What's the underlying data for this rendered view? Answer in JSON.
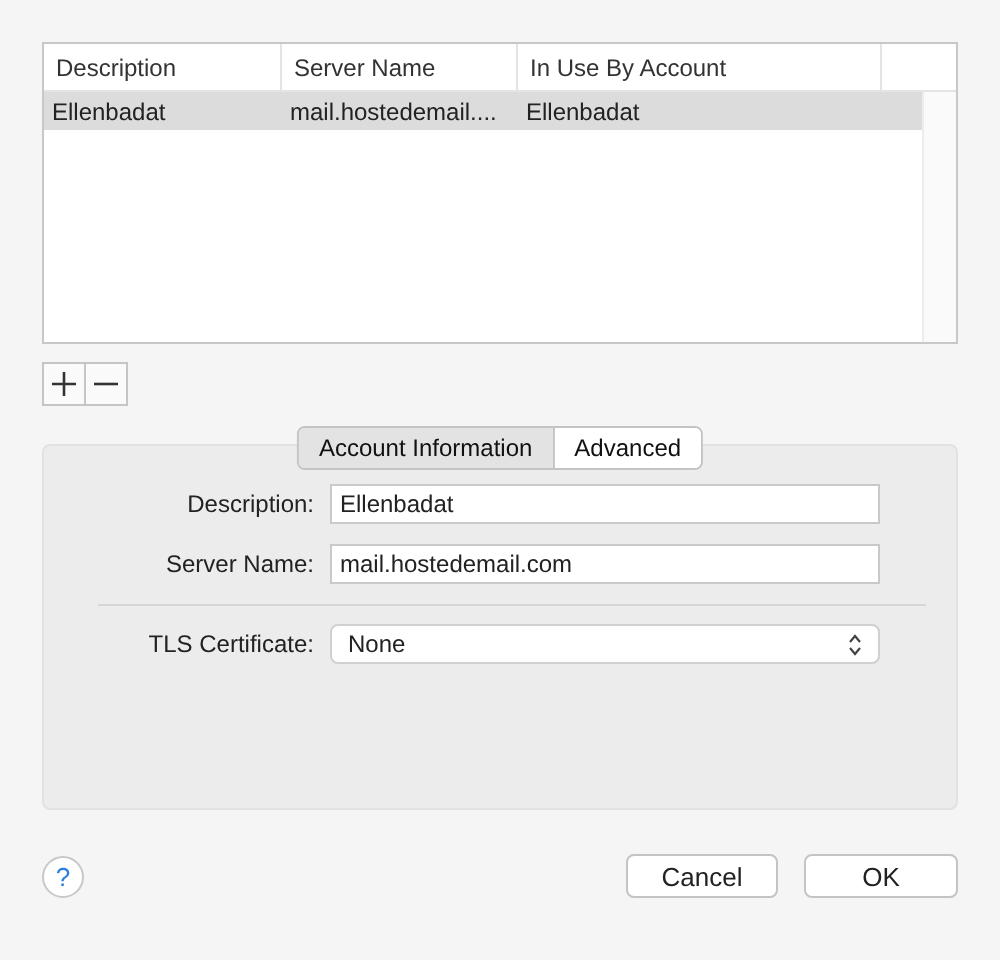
{
  "table": {
    "columns": [
      "Description",
      "Server Name",
      "In Use By Account"
    ],
    "rows": [
      {
        "cells": [
          "Ellenbadat",
          "mail.hostedemail....",
          "Ellenbadat"
        ],
        "selected": true
      }
    ]
  },
  "tabs": [
    {
      "label": "Account Information",
      "selected": true
    },
    {
      "label": "Advanced",
      "selected": false
    }
  ],
  "form": {
    "fields": [
      {
        "kind": "text",
        "label": "Description:",
        "value": "Ellenbadat"
      },
      {
        "kind": "text",
        "label": "Server Name:",
        "value": "mail.hostedemail.com"
      },
      {
        "kind": "separator"
      },
      {
        "kind": "select",
        "label": "TLS Certificate:",
        "value": "None"
      }
    ]
  },
  "help": "?",
  "buttons": [
    "Cancel",
    "OK"
  ]
}
